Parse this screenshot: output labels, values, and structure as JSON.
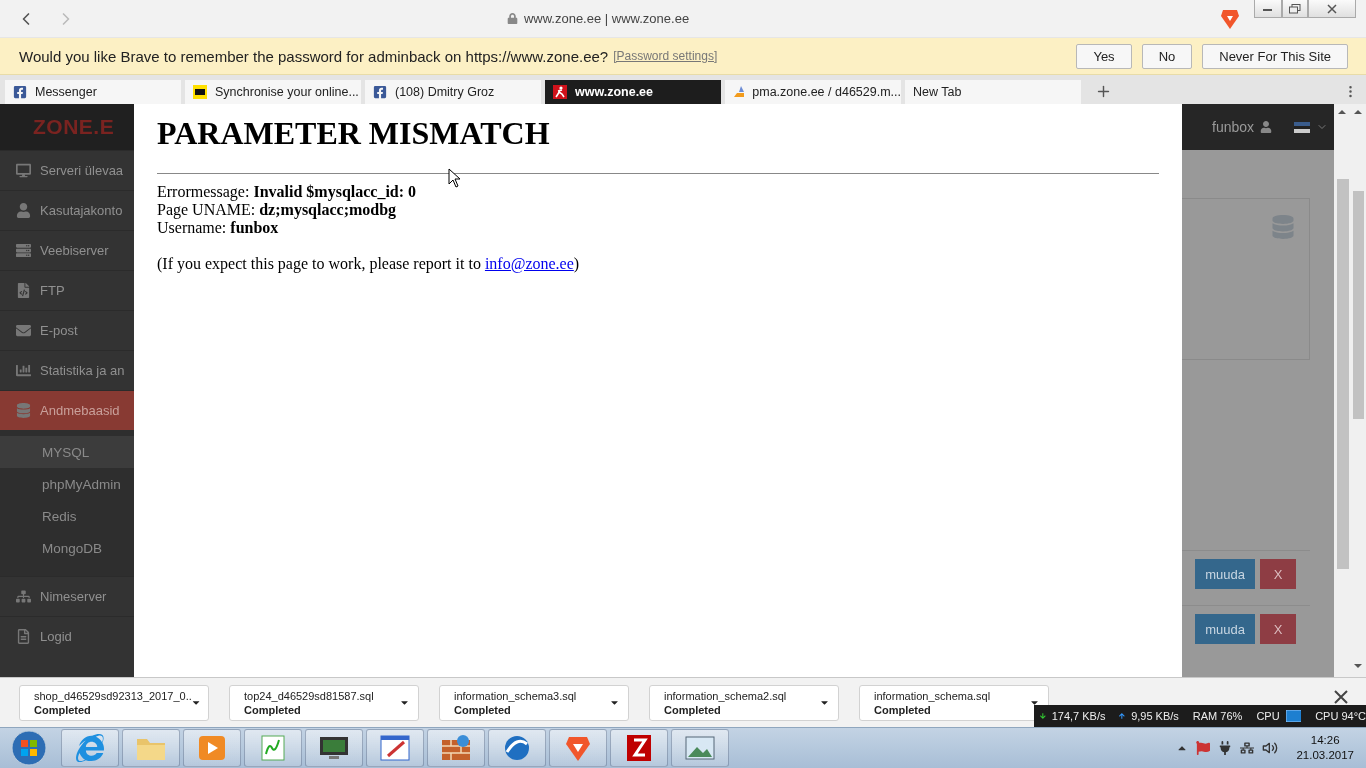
{
  "browser": {
    "address": "www.zone.ee | www.zone.ee"
  },
  "password_prompt": {
    "message": "Would you like Brave to remember the password for adminback on https://www.zone.ee?",
    "link": "[Password settings]",
    "buttons": [
      "Yes",
      "No",
      "Never For This Site"
    ]
  },
  "tabs": [
    {
      "label": "Messenger",
      "kind": "facebook",
      "selected": false
    },
    {
      "label": "Synchronise your online...",
      "kind": "tag",
      "selected": false
    },
    {
      "label": "(108) Dmitry Groz",
      "kind": "facebook",
      "selected": false
    },
    {
      "label": "www.zone.ee",
      "kind": "runner",
      "selected": true
    },
    {
      "label": "pma.zone.ee / d46529.m...",
      "kind": "pma",
      "selected": false
    },
    {
      "label": "New Tab",
      "kind": "none",
      "selected": false
    }
  ],
  "app": {
    "logo": "ZONE.E",
    "user": "funbox",
    "sidebar": [
      {
        "label": "Serveri ülevaa",
        "kind": "desktop",
        "selected": false
      },
      {
        "label": "Kasutajakonto",
        "kind": "user",
        "selected": false
      },
      {
        "label": "Veebiserver",
        "kind": "server",
        "selected": false
      },
      {
        "label": "FTP",
        "kind": "code",
        "selected": false
      },
      {
        "label": "E-post",
        "kind": "mail",
        "selected": false
      },
      {
        "label": "Statistika ja an",
        "kind": "stats",
        "selected": false
      },
      {
        "label": "Andmebaasid",
        "kind": "database",
        "selected": true,
        "children": [
          {
            "label": "MYSQL",
            "selected": true
          },
          {
            "label": "phpMyAdmin",
            "selected": false
          },
          {
            "label": "Redis",
            "selected": false
          },
          {
            "label": "MongoDB",
            "selected": false
          }
        ]
      },
      {
        "label": "Nimeserver",
        "kind": "dns",
        "selected": false
      },
      {
        "label": "Logid",
        "kind": "logs",
        "selected": false
      }
    ],
    "rows": [
      {
        "edit": "muuda",
        "delete": "X"
      },
      {
        "edit": "muuda",
        "delete": "X"
      }
    ]
  },
  "error_page": {
    "title": "PARAMETER MISMATCH",
    "lines": [
      "Errormessage: **Invalid $mysqlacc_id: 0**",
      "Page UNAME: **dz;mysqlacc;modbg**",
      "Username: **funbox**"
    ],
    "report": {
      "before": "(If you expect this page to work, please report it to ",
      "link": "info@zone.ee",
      "after": ")"
    }
  },
  "downloads": [
    {
      "file": "shop_d46529sd92313_2017_0..",
      "status": "Completed"
    },
    {
      "file": "top24_d46529sd81587.sql",
      "status": "Completed"
    },
    {
      "file": "information_schema3.sql",
      "status": "Completed"
    },
    {
      "file": "information_schema2.sql",
      "status": "Completed"
    },
    {
      "file": "information_schema.sql",
      "status": "Completed"
    }
  ],
  "net_meter": {
    "down": "174,7 KB/s",
    "up": "9,95 KB/s",
    "ram": "RAM 76%",
    "cpu": "CPU",
    "cpu_temp": "CPU 94°C"
  },
  "taskbar": {
    "apps": [
      {
        "kind": "ie"
      },
      {
        "kind": "folder"
      },
      {
        "kind": "media"
      },
      {
        "kind": "notepad"
      },
      {
        "kind": "monitor"
      },
      {
        "kind": "paint"
      },
      {
        "kind": "firewall"
      },
      {
        "kind": "swirl"
      },
      {
        "kind": "lion"
      },
      {
        "kind": "filezilla"
      },
      {
        "kind": "photo"
      }
    ],
    "time": "14:26",
    "date": "21.03.2017"
  }
}
